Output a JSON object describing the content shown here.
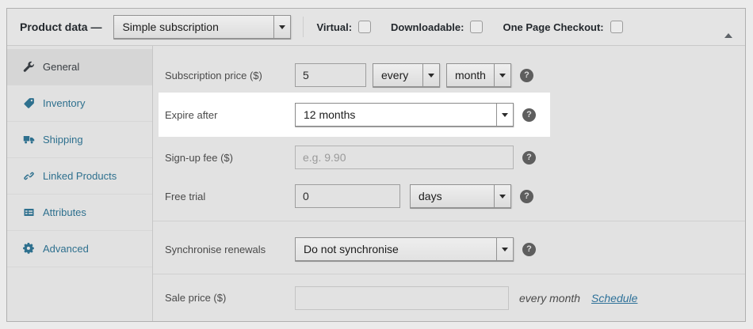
{
  "header": {
    "title": "Product data —",
    "product_type": "Simple subscription",
    "virtual_label": "Virtual:",
    "downloadable_label": "Downloadable:",
    "one_page_checkout_label": "One Page Checkout:"
  },
  "sidebar": {
    "items": [
      {
        "label": "General",
        "icon": "wrench-icon",
        "active": true
      },
      {
        "label": "Inventory",
        "icon": "tag-icon",
        "active": false
      },
      {
        "label": "Shipping",
        "icon": "truck-icon",
        "active": false
      },
      {
        "label": "Linked Products",
        "icon": "link-icon",
        "active": false
      },
      {
        "label": "Attributes",
        "icon": "list-card-icon",
        "active": false
      },
      {
        "label": "Advanced",
        "icon": "gear-icon",
        "active": false
      }
    ]
  },
  "main": {
    "help_glyph": "?",
    "subscription_price": {
      "label": "Subscription price ($)",
      "value": "5",
      "interval": "every",
      "period": "month"
    },
    "expire_after": {
      "label": "Expire after",
      "value": "12 months",
      "highlighted": true
    },
    "signup_fee": {
      "label": "Sign-up fee ($)",
      "value": "",
      "placeholder": "e.g. 9.90"
    },
    "free_trial": {
      "label": "Free trial",
      "value": "0",
      "period": "days"
    },
    "synchronise_renewals": {
      "label": "Synchronise renewals",
      "value": "Do not synchronise"
    },
    "sale_price": {
      "label": "Sale price ($)",
      "value": "",
      "suffix": "every month",
      "schedule_link": "Schedule"
    }
  },
  "colors": {
    "panel_bg": "#e2e2e2",
    "highlight_bg": "#ffffff",
    "sidebar_link_blue": "#2e708e",
    "schedule_link_blue": "#2e7199",
    "help_icon_bg": "#5e5e5e"
  }
}
